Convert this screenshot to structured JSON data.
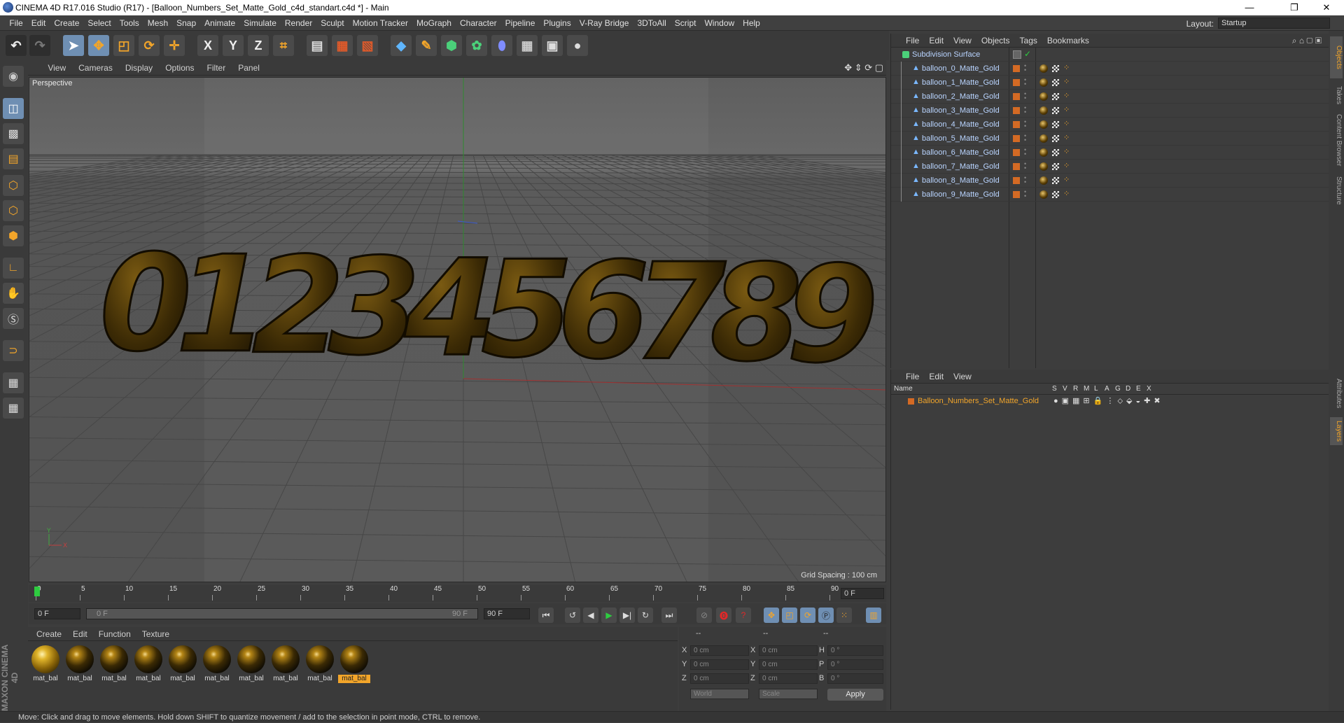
{
  "window": {
    "title": "CINEMA 4D R17.016 Studio (R17) - [Balloon_Numbers_Set_Matte_Gold_c4d_standart.c4d *] - Main",
    "min": "—",
    "max": "❐",
    "close": "✕"
  },
  "menubar": {
    "items": [
      "File",
      "Edit",
      "Create",
      "Select",
      "Tools",
      "Mesh",
      "Snap",
      "Animate",
      "Simulate",
      "Render",
      "Sculpt",
      "Motion Tracker",
      "MoGraph",
      "Character",
      "Pipeline",
      "Plugins",
      "V-Ray Bridge",
      "3DToAll",
      "Script",
      "Window",
      "Help"
    ],
    "layout_label": "Layout:",
    "layout_value": "Startup"
  },
  "toolbar": {
    "x_label": "X",
    "y_label": "Y",
    "z_label": "Z"
  },
  "viewport": {
    "menu": [
      "View",
      "Cameras",
      "Display",
      "Options",
      "Filter",
      "Panel"
    ],
    "label": "Perspective",
    "grid_spacing": "Grid Spacing : 100 cm",
    "digits": [
      "0",
      "1",
      "2",
      "3",
      "4",
      "5",
      "6",
      "7",
      "8",
      "9"
    ]
  },
  "timeline": {
    "ticks": [
      "0",
      "5",
      "10",
      "15",
      "20",
      "25",
      "30",
      "35",
      "40",
      "45",
      "50",
      "55",
      "60",
      "65",
      "70",
      "75",
      "80",
      "85",
      "90"
    ],
    "current_frame": "0 F",
    "start_field": "0 F",
    "range_start": "0 F",
    "range_end": "90 F",
    "end_field": "90 F"
  },
  "material_manager": {
    "menu": [
      "Create",
      "Edit",
      "Function",
      "Texture"
    ],
    "materials": [
      "mat_bal",
      "mat_bal",
      "mat_bal",
      "mat_bal",
      "mat_bal",
      "mat_bal",
      "mat_bal",
      "mat_bal",
      "mat_bal",
      "mat_bal"
    ]
  },
  "coordinates": {
    "header": "--",
    "x_pos": "0 cm",
    "y_pos": "0 cm",
    "z_pos": "0 cm",
    "x_size": "0 cm",
    "y_size": "0 cm",
    "z_size": "0 cm",
    "h": "0 °",
    "p": "0 °",
    "b": "0 °",
    "labels": {
      "x": "X",
      "y": "Y",
      "z": "Z",
      "h": "H",
      "p": "P",
      "b": "B"
    },
    "mode1": "World",
    "mode2": "Scale",
    "apply": "Apply"
  },
  "object_manager": {
    "menu": [
      "File",
      "Edit",
      "View",
      "Objects",
      "Tags",
      "Bookmarks"
    ],
    "root": "Subdivision Surface",
    "objects": [
      "balloon_0_Matte_Gold",
      "balloon_1_Matte_Gold",
      "balloon_2_Matte_Gold",
      "balloon_3_Matte_Gold",
      "balloon_4_Matte_Gold",
      "balloon_5_Matte_Gold",
      "balloon_6_Matte_Gold",
      "balloon_7_Matte_Gold",
      "balloon_8_Matte_Gold",
      "balloon_9_Matte_Gold"
    ]
  },
  "layer_manager": {
    "menu": [
      "File",
      "Edit",
      "View"
    ],
    "name_header": "Name",
    "flags": [
      "S",
      "V",
      "R",
      "M",
      "L",
      "A",
      "G",
      "D",
      "E",
      "X"
    ],
    "layer": "Balloon_Numbers_Set_Matte_Gold"
  },
  "right_tabs": [
    "Objects",
    "Takes",
    "Content Browser",
    "Structure",
    "Attributes",
    "Layers"
  ],
  "status": "Move: Click and drag to move elements. Hold down SHIFT to quantize movement / add to the selection in point mode, CTRL to remove.",
  "brand": "MAXON CINEMA 4D",
  "colors": {
    "accent": "#f2a52a",
    "balloon": "#3b2a05",
    "object_name": "#b9d4ff",
    "layer_color": "#d46a24"
  }
}
